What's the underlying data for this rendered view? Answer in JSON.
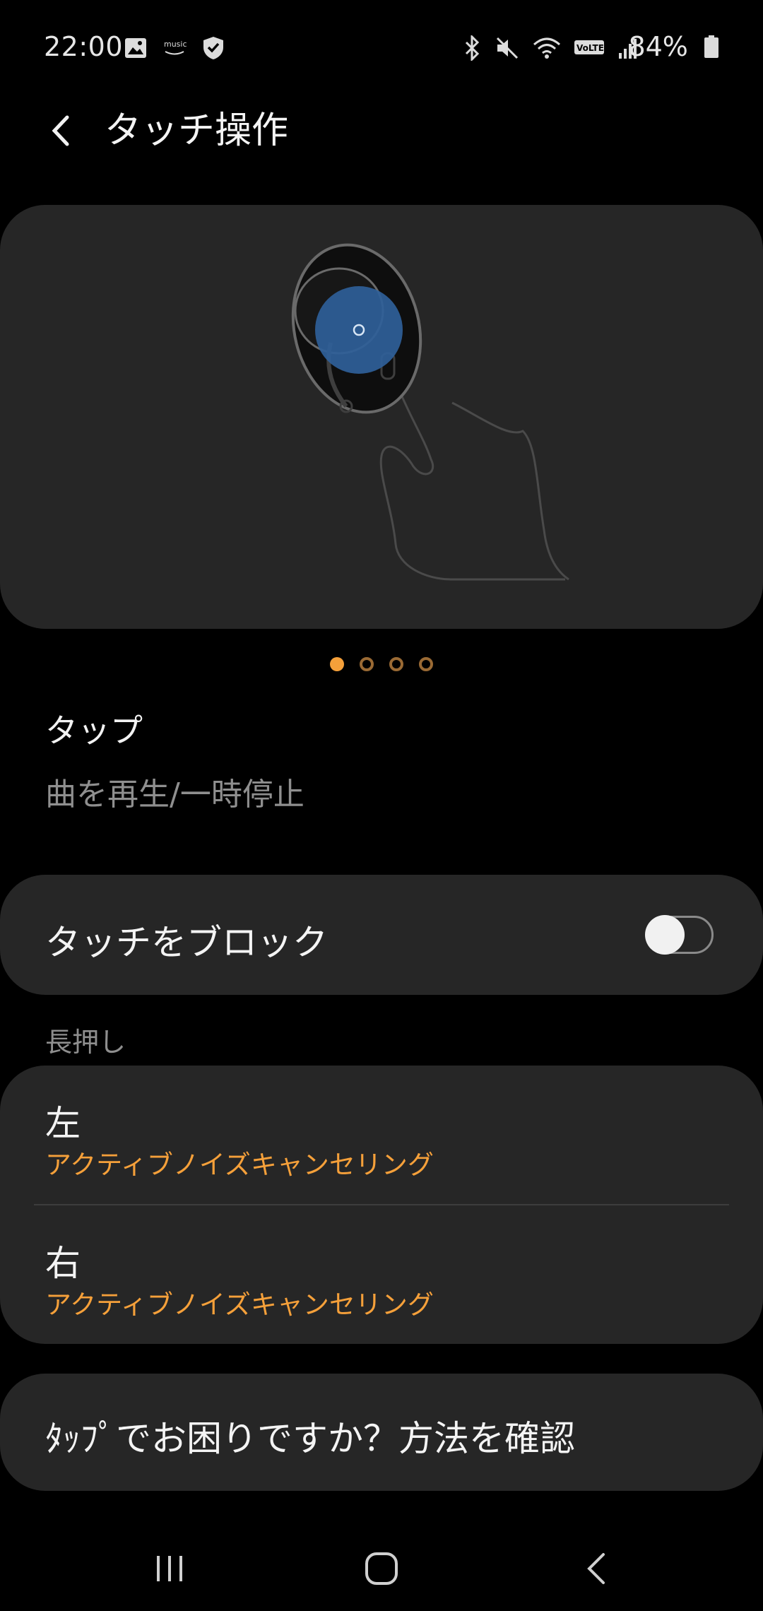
{
  "status_bar": {
    "time": "22:00",
    "left_icons": [
      "image-icon",
      "amazon-music-icon",
      "shield-icon"
    ],
    "right_icons": [
      "bluetooth-icon",
      "mute-icon",
      "wifi-icon",
      "volte-icon",
      "signal-icon"
    ],
    "volte_label": "VoLTE",
    "battery_percent": "84%"
  },
  "header": {
    "title": "タッチ操作"
  },
  "carousel": {
    "page_count": 4,
    "active_index": 0
  },
  "gesture": {
    "title": "タップ",
    "description": "曲を再生/一時停止"
  },
  "block_touch": {
    "label": "タッチをブロック",
    "enabled": false
  },
  "long_press": {
    "section_title": "長押し",
    "left": {
      "title": "左",
      "value": "アクティブノイズキャンセリング"
    },
    "right": {
      "title": "右",
      "value": "アクティブノイズキャンセリング"
    }
  },
  "help": {
    "text": "ﾀｯﾌﾟでお困りですか？方法を確認"
  },
  "colors": {
    "accent": "#f5a03a",
    "card": "#262626",
    "touch_highlight": "#2f5f99"
  }
}
